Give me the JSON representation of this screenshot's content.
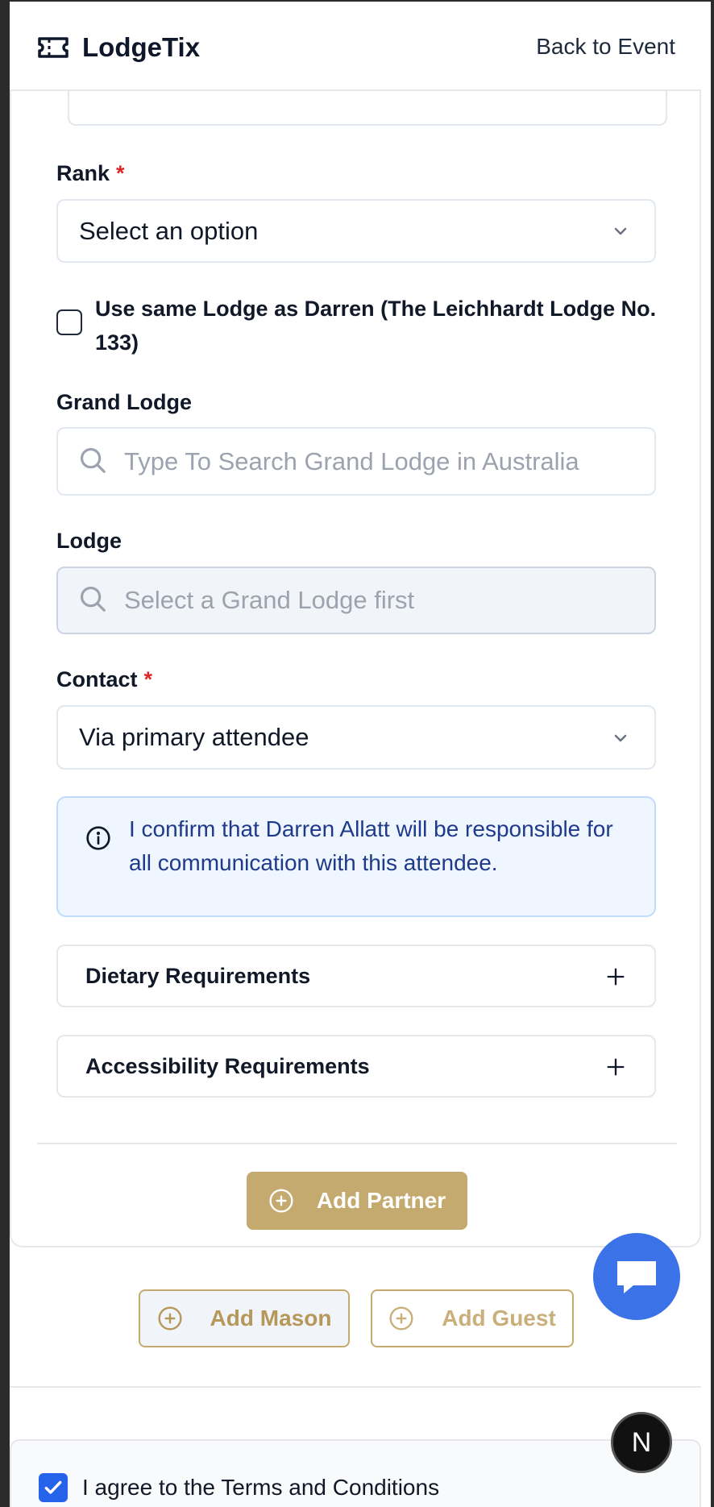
{
  "header": {
    "brand": "LodgeTix",
    "back_link": "Back to Event"
  },
  "form": {
    "rank": {
      "label": "Rank",
      "required_mark": "*",
      "value": "Select an option"
    },
    "same_lodge": {
      "checked": false,
      "label": "Use same Lodge as Darren (The Leichhardt Lodge No. 133)"
    },
    "grand_lodge": {
      "label": "Grand Lodge",
      "placeholder": "Type To Search Grand Lodge in Australia"
    },
    "lodge": {
      "label": "Lodge",
      "placeholder": "Select a Grand Lodge first"
    },
    "contact": {
      "label": "Contact",
      "required_mark": "*",
      "value": "Via primary attendee"
    },
    "info": {
      "text": "I confirm that Darren Allatt will be responsible for all communication with this attendee."
    },
    "accordions": [
      {
        "label": "Dietary Requirements"
      },
      {
        "label": "Accessibility Requirements"
      }
    ],
    "add_partner": "Add Partner"
  },
  "actions": {
    "add_mason": "Add Mason",
    "add_guest": "Add Guest"
  },
  "terms": {
    "checked": true,
    "label": "I agree to the Terms and Conditions"
  },
  "floating": {
    "dev_badge": "N"
  },
  "colors": {
    "gold": "#c4aa6e",
    "chat_blue": "#3b72e8",
    "info_bg": "#eff6ff",
    "info_text": "#1e3a8a",
    "required": "#dc2626"
  }
}
